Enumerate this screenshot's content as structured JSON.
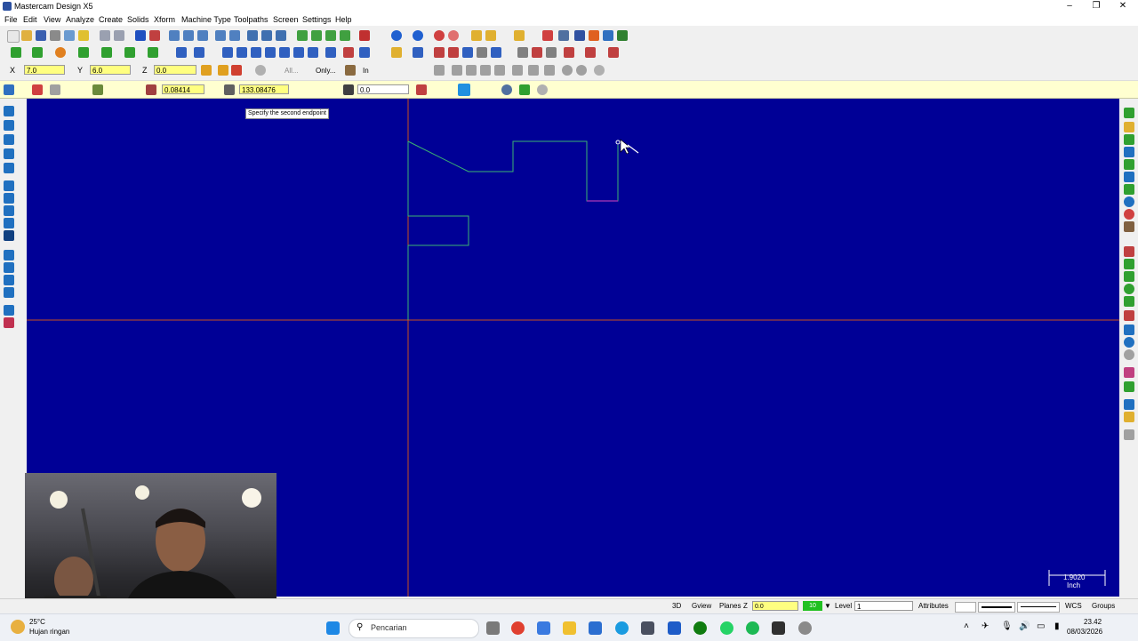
{
  "window": {
    "title": "Mastercam Design X5",
    "controls": [
      "–",
      "❐",
      "✕"
    ]
  },
  "menu": [
    "File",
    "Edit",
    "View",
    "Analyze",
    "Create",
    "Solids",
    "Xform",
    "Machine Type",
    "Toolpaths",
    "Screen",
    "Settings",
    "Help"
  ],
  "coord_bar": {
    "x_label": "X",
    "x_value": "7.0",
    "y_label": "Y",
    "y_value": "6.0",
    "z_label": "Z",
    "z_value": "0.0",
    "all_button": "All...",
    "only_button": "Only...",
    "units": "In"
  },
  "ribbon": {
    "length_value": "0.08414",
    "angle_value": "133.08476",
    "dim_value": "0.0"
  },
  "prompt": "Specify the second endpoint",
  "scale": {
    "value": "1.9020",
    "unit": "Inch"
  },
  "statusbar": {
    "view_3d": "3D",
    "gview": "Gview",
    "planes": "Planes",
    "z_label": "Z",
    "z_value": "0.0",
    "z_depth": "10",
    "level_label": "Level",
    "level_value": "1",
    "attributes": "Attributes",
    "wcs": "WCS",
    "groups": "Groups"
  },
  "taskbar": {
    "weather_temp": "25°C",
    "weather_desc": "Hujan ringan",
    "search_placeholder": "Pencarian",
    "time": "23.42",
    "date": "08/03/2026"
  },
  "colors": {
    "canvas": "#000096",
    "geometry": "#3cb371",
    "axis": "#c8501e",
    "selected": "#9030b0",
    "ribbon": "#ffffd0"
  }
}
